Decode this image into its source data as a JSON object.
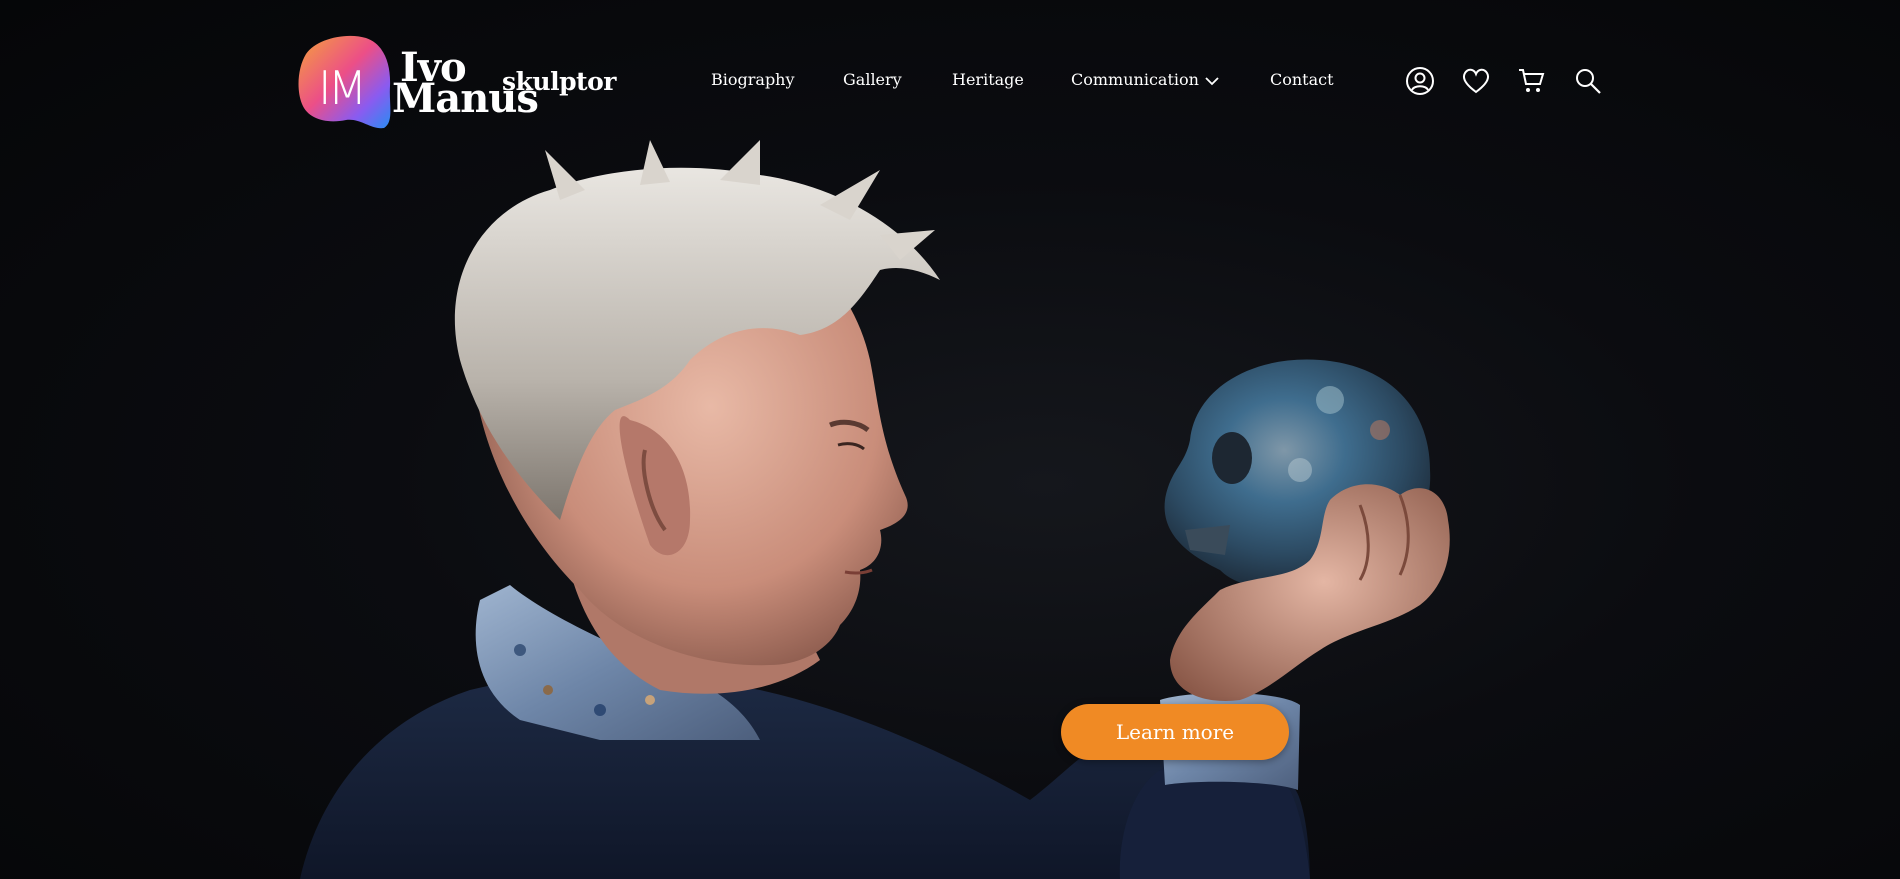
{
  "brand": {
    "monogram": "IM",
    "name_line1": "Ivo",
    "name_line2": "Manus",
    "subtitle": "skulptor",
    "gradient": [
      "#f5a23b",
      "#ec4f87",
      "#8a5bf0",
      "#2a8cf2"
    ]
  },
  "nav": {
    "items": [
      {
        "label": "Biography"
      },
      {
        "label": "Gallery"
      },
      {
        "label": "Heritage"
      },
      {
        "label": "Communication",
        "has_dropdown": true
      },
      {
        "label": "Contact"
      }
    ]
  },
  "header_icons": [
    {
      "name": "account-icon"
    },
    {
      "name": "heart-icon"
    },
    {
      "name": "cart-icon"
    },
    {
      "name": "search-icon"
    }
  ],
  "hero": {
    "cta_label": "Learn more",
    "cta_color": "#f08a24",
    "background": "#060709"
  }
}
